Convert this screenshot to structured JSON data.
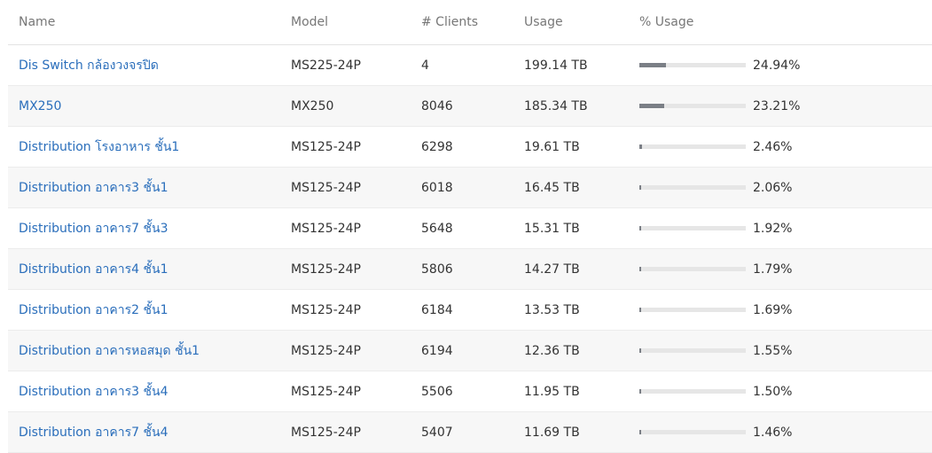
{
  "columns": {
    "name": "Name",
    "model": "Model",
    "clients": "# Clients",
    "usage": "Usage",
    "pct_usage": "% Usage"
  },
  "rows": [
    {
      "name": "Dis Switch กล้องวงจรปิด",
      "model": "MS225-24P",
      "clients": "4",
      "usage": "199.14 TB",
      "pct": "24.94%",
      "pct_value": 24.94
    },
    {
      "name": "MX250",
      "model": "MX250",
      "clients": "8046",
      "usage": "185.34 TB",
      "pct": "23.21%",
      "pct_value": 23.21
    },
    {
      "name": "Distribution โรงอาหาร ชั้น1",
      "model": "MS125-24P",
      "clients": "6298",
      "usage": "19.61 TB",
      "pct": "2.46%",
      "pct_value": 2.46
    },
    {
      "name": "Distribution อาคาร3 ชั้น1",
      "model": "MS125-24P",
      "clients": "6018",
      "usage": "16.45 TB",
      "pct": "2.06%",
      "pct_value": 2.06
    },
    {
      "name": "Distribution อาคาร7 ชั้น3",
      "model": "MS125-24P",
      "clients": "5648",
      "usage": "15.31 TB",
      "pct": "1.92%",
      "pct_value": 1.92
    },
    {
      "name": "Distribution อาคาร4 ชั้น1",
      "model": "MS125-24P",
      "clients": "5806",
      "usage": "14.27 TB",
      "pct": "1.79%",
      "pct_value": 1.79
    },
    {
      "name": "Distribution อาคาร2 ชั้น1",
      "model": "MS125-24P",
      "clients": "6184",
      "usage": "13.53 TB",
      "pct": "1.69%",
      "pct_value": 1.69
    },
    {
      "name": "Distribution อาคารหอสมุด ชั้น1",
      "model": "MS125-24P",
      "clients": "6194",
      "usage": "12.36 TB",
      "pct": "1.55%",
      "pct_value": 1.55
    },
    {
      "name": "Distribution อาคาร3 ชั้น4",
      "model": "MS125-24P",
      "clients": "5506",
      "usage": "11.95 TB",
      "pct": "1.50%",
      "pct_value": 1.5
    },
    {
      "name": "Distribution อาคาร7 ชั้น4",
      "model": "MS125-24P",
      "clients": "5407",
      "usage": "11.69 TB",
      "pct": "1.46%",
      "pct_value": 1.46
    }
  ],
  "colors": {
    "link": "#2a6ebb",
    "bar_fill": "#7b7f86",
    "bar_track": "#e6e6e6",
    "alt_row": "#f7f7f7"
  }
}
